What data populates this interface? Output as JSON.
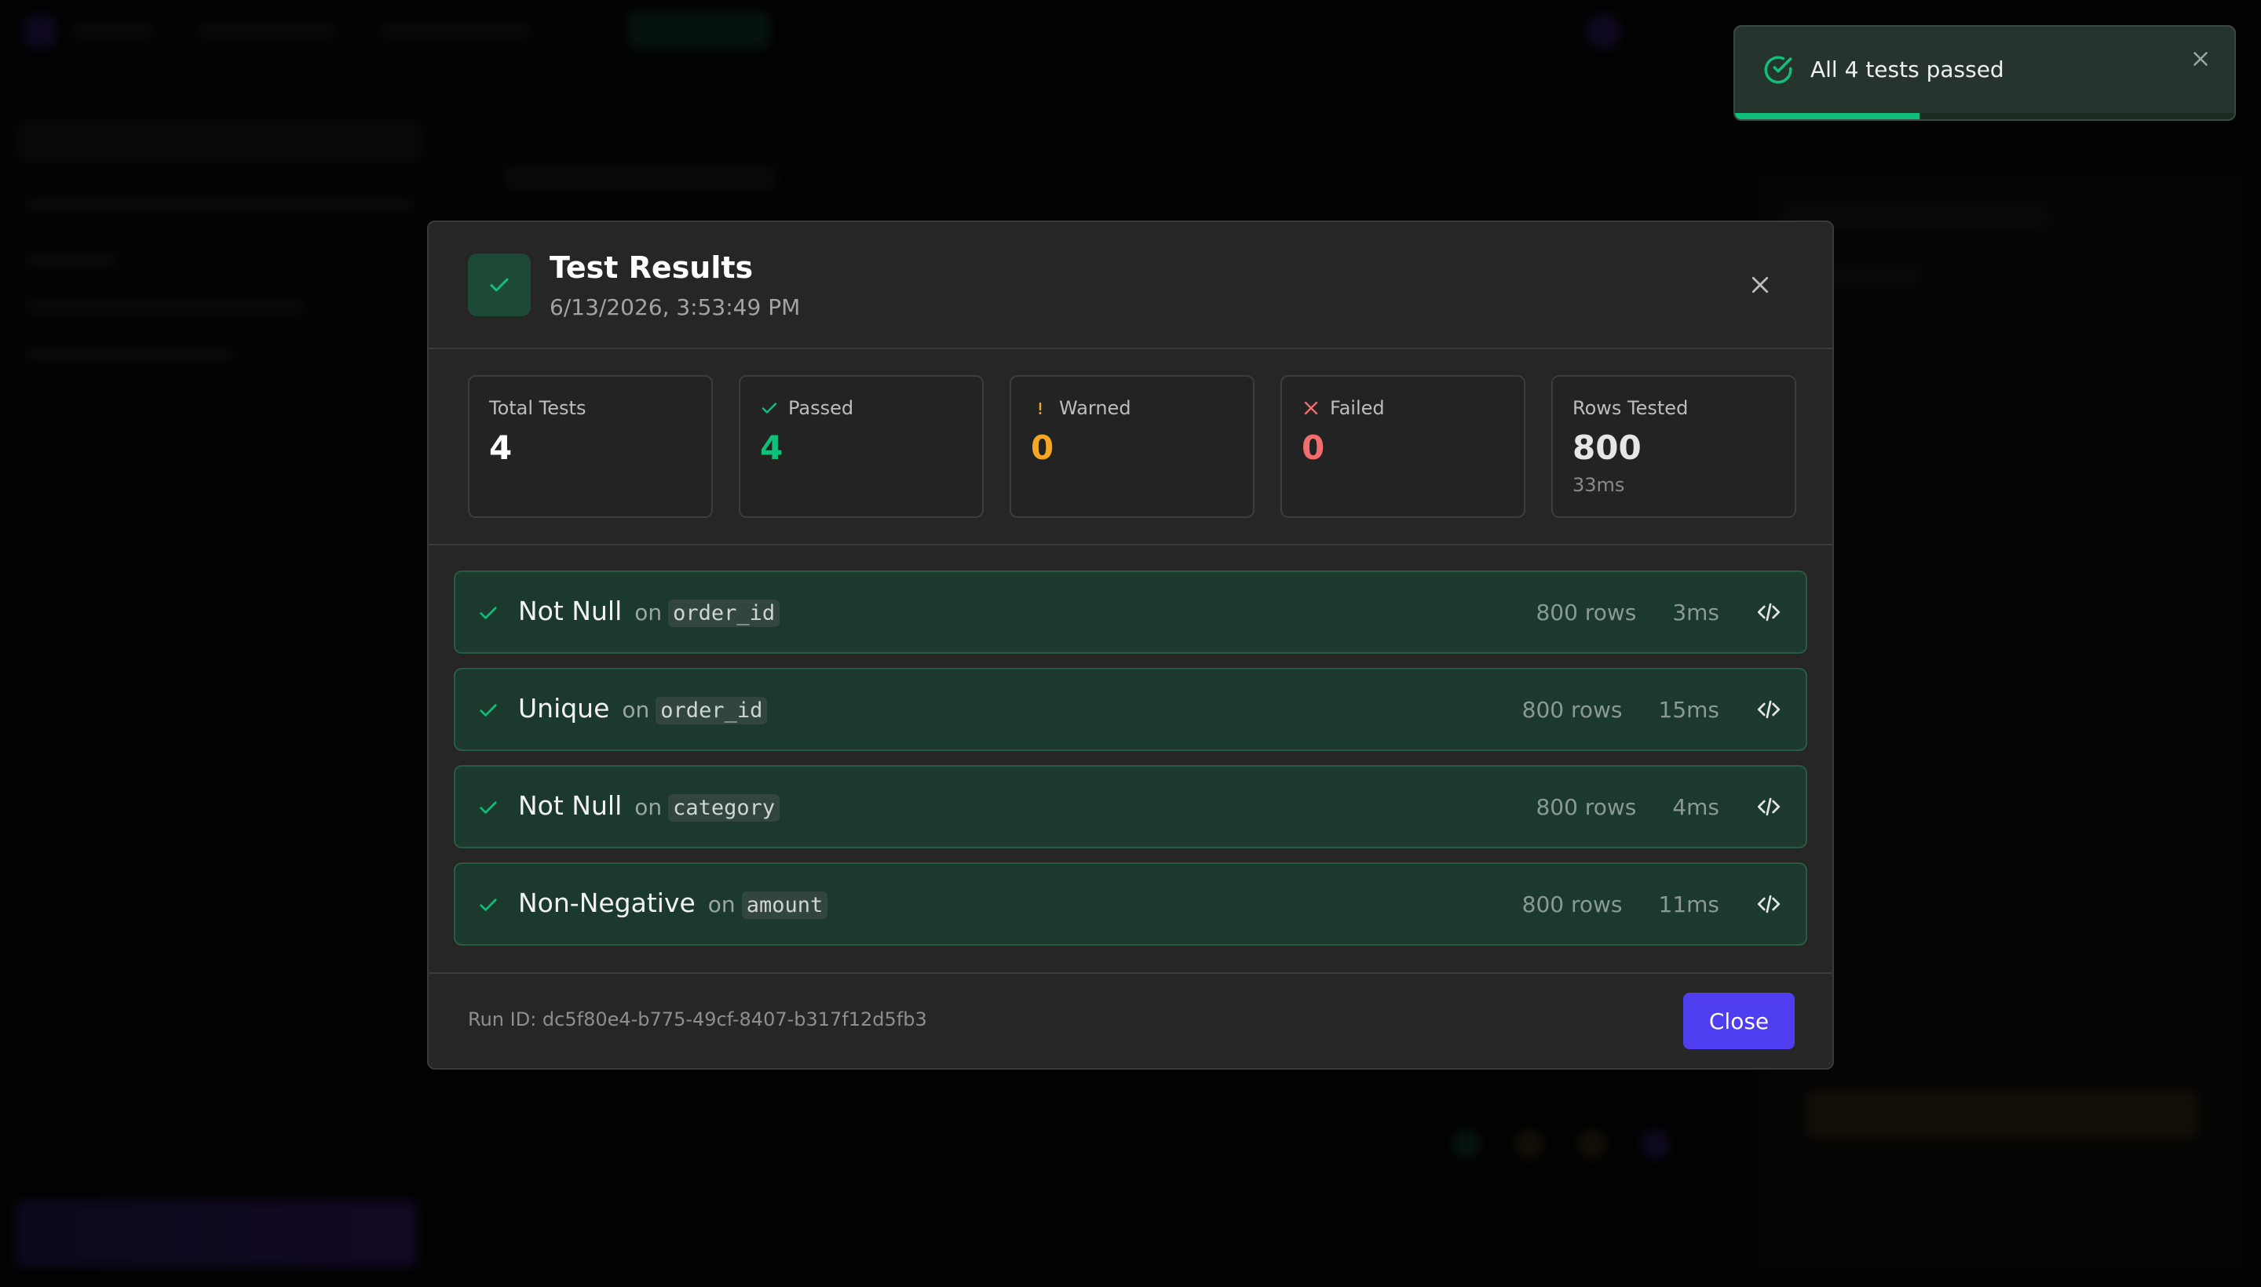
{
  "colors": {
    "accent": "#4f3df0",
    "success": "#10c07a",
    "warning": "#f5a623",
    "danger": "#f26d6d",
    "row_bg": "#1b3a2d"
  },
  "toast": {
    "message": "All 4 tests passed",
    "progress_percent": 37,
    "icon": "check-circle-icon",
    "close_icon": "close-icon"
  },
  "modal": {
    "title": "Test Results",
    "subtitle": "6/13/2026, 3:53:49 PM",
    "header_icon": "check-icon",
    "close_icon": "close-icon"
  },
  "stats": {
    "total": {
      "label": "Total Tests",
      "value": "4"
    },
    "passed": {
      "label": "Passed",
      "value": "4",
      "icon": "check-icon"
    },
    "warned": {
      "label": "Warned",
      "value": "0",
      "icon": "warning-icon"
    },
    "failed": {
      "label": "Failed",
      "value": "0",
      "icon": "x-icon"
    },
    "rows": {
      "label": "Rows Tested",
      "value": "800",
      "sub": "33ms"
    }
  },
  "tests": [
    {
      "name": "Not Null",
      "on": "on",
      "column": "order_id",
      "rows": "800 rows",
      "time": "3ms"
    },
    {
      "name": "Unique",
      "on": "on",
      "column": "order_id",
      "rows": "800 rows",
      "time": "15ms"
    },
    {
      "name": "Not Null",
      "on": "on",
      "column": "category",
      "rows": "800 rows",
      "time": "4ms"
    },
    {
      "name": "Non-Negative",
      "on": "on",
      "column": "amount",
      "rows": "800 rows",
      "time": "11ms"
    }
  ],
  "footer": {
    "run_id": "Run ID: dc5f80e4-b775-49cf-8407-b317f12d5fb3",
    "close_label": "Close"
  }
}
